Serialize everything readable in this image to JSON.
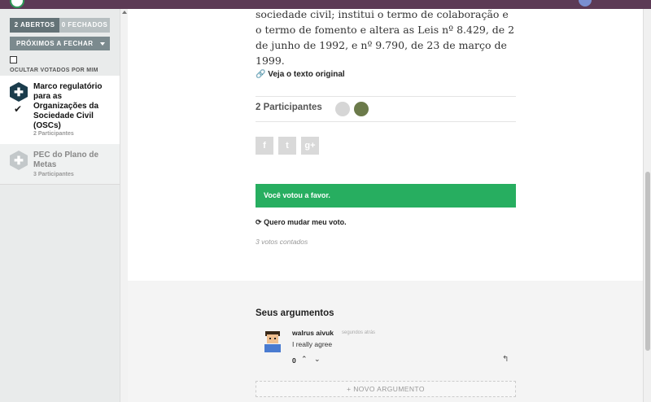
{
  "sidebar": {
    "tabs": [
      {
        "label": "2 ABERTOS"
      },
      {
        "label": "0 FECHADOS"
      }
    ],
    "sort_label": "PRÓXIMOS A FECHAR",
    "hide_voted_label": "OCULTAR VOTADOS POR MIM",
    "proposals": [
      {
        "title": "Marco regulatório para as Organizações da Sociedade Civil (OSCs)",
        "participants": "2 Participantes",
        "voted": true
      },
      {
        "title": "PEC do Plano de Metas",
        "participants": "3 Participantes",
        "voted": false
      }
    ]
  },
  "main": {
    "paragraph": "sociedade civil; institui o termo de colaboração e o termo de fomento e altera as Leis nº 8.429, de 2 de junho de 1992, e nº 9.790, de 23 de março de 1999.",
    "original_link": "Veja o texto original",
    "participants_label": "2 Participantes",
    "share": {
      "facebook": "f",
      "twitter": "t",
      "google": "g+"
    },
    "vote_banner": "Você votou a favor.",
    "change_vote": "Quero mudar meu voto.",
    "votes_count": "3 votos contados"
  },
  "arguments": {
    "title": "Seus argumentos",
    "items": [
      {
        "author": "walrus aivuk",
        "time": "segundos atrás",
        "text": "I really agree",
        "score": "0"
      }
    ],
    "new_label": "+ NOVO ARGUMENTO"
  },
  "colors": {
    "topbar": "#5c3a55",
    "success": "#27ae60",
    "tab_active": "#647377",
    "proposal_icon": "#1a3c4c"
  }
}
